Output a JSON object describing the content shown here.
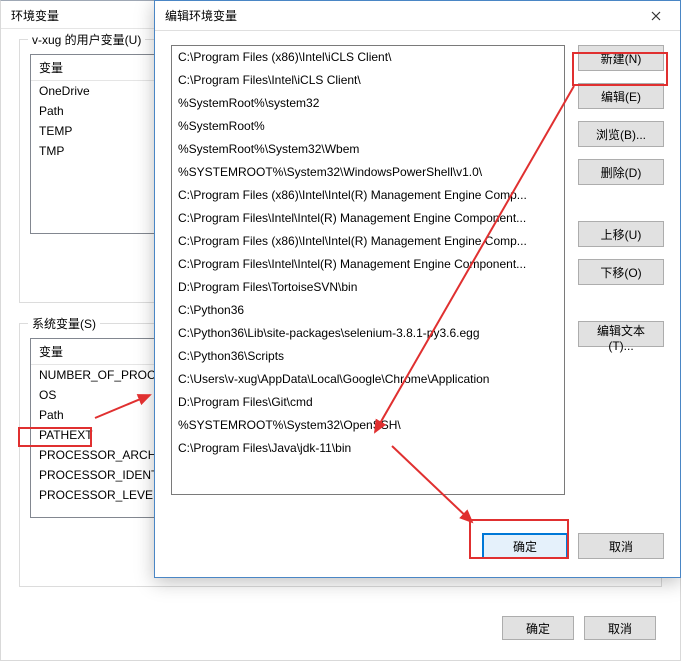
{
  "bg": {
    "title": "环境变量",
    "user_group_legend": "v-xug 的用户变量(U)",
    "col_variable": "变量",
    "user_vars": [
      "OneDrive",
      "Path",
      "TEMP",
      "TMP"
    ],
    "sys_group_legend": "系统变量(S)",
    "sys_vars": [
      "NUMBER_OF_PROC",
      "OS",
      "Path",
      "PATHEXT",
      "PROCESSOR_ARCH",
      "PROCESSOR_IDENT",
      "PROCESSOR_LEVEL"
    ],
    "ok": "确定",
    "cancel": "取消"
  },
  "fg": {
    "title": "编辑环境变量",
    "paths": [
      "C:\\Program Files (x86)\\Intel\\iCLS Client\\",
      "C:\\Program Files\\Intel\\iCLS Client\\",
      "%SystemRoot%\\system32",
      "%SystemRoot%",
      "%SystemRoot%\\System32\\Wbem",
      "%SYSTEMROOT%\\System32\\WindowsPowerShell\\v1.0\\",
      "C:\\Program Files (x86)\\Intel\\Intel(R) Management Engine Comp...",
      "C:\\Program Files\\Intel\\Intel(R) Management Engine Component...",
      "C:\\Program Files (x86)\\Intel\\Intel(R) Management Engine Comp...",
      "C:\\Program Files\\Intel\\Intel(R) Management Engine Component...",
      "D:\\Program Files\\TortoiseSVN\\bin",
      "C:\\Python36",
      "C:\\Python36\\Lib\\site-packages\\selenium-3.8.1-py3.6.egg",
      "C:\\Python36\\Scripts",
      "C:\\Users\\v-xug\\AppData\\Local\\Google\\Chrome\\Application",
      "D:\\Program Files\\Git\\cmd",
      "%SYSTEMROOT%\\System32\\OpenSSH\\",
      "C:\\Program Files\\Java\\jdk-11\\bin"
    ],
    "buttons": {
      "new": "新建(N)",
      "edit": "编辑(E)",
      "browse": "浏览(B)...",
      "delete": "删除(D)",
      "up": "上移(U)",
      "down": "下移(O)",
      "edit_text": "编辑文本(T)...",
      "ok": "确定",
      "cancel": "取消"
    }
  }
}
